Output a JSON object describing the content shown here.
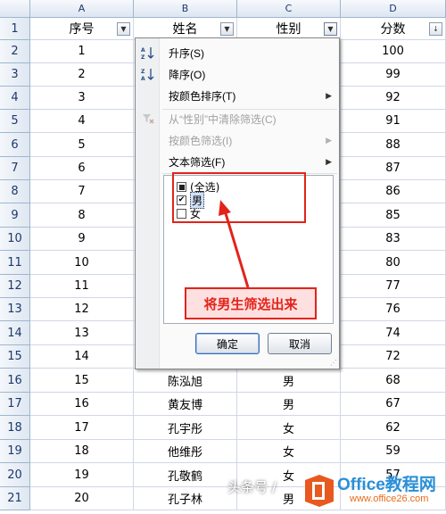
{
  "columns": [
    "A",
    "B",
    "C",
    "D"
  ],
  "row_numbers": [
    "1",
    "2",
    "3",
    "4",
    "5",
    "6",
    "7",
    "8",
    "9",
    "10",
    "11",
    "12",
    "13",
    "14",
    "15",
    "16",
    "17",
    "18",
    "19",
    "20",
    "21"
  ],
  "headers": {
    "seq": "序号",
    "name": "姓名",
    "gender": "性别",
    "score": "分数"
  },
  "rows": [
    {
      "seq": "1",
      "name": "",
      "gender": "",
      "score": "100"
    },
    {
      "seq": "2",
      "name": "",
      "gender": "",
      "score": "99"
    },
    {
      "seq": "3",
      "name": "",
      "gender": "",
      "score": "92"
    },
    {
      "seq": "4",
      "name": "",
      "gender": "",
      "score": "91"
    },
    {
      "seq": "5",
      "name": "",
      "gender": "",
      "score": "88"
    },
    {
      "seq": "6",
      "name": "",
      "gender": "",
      "score": "87"
    },
    {
      "seq": "7",
      "name": "",
      "gender": "",
      "score": "86"
    },
    {
      "seq": "8",
      "name": "",
      "gender": "",
      "score": "85"
    },
    {
      "seq": "9",
      "name": "",
      "gender": "",
      "score": "83"
    },
    {
      "seq": "10",
      "name": "",
      "gender": "",
      "score": "80"
    },
    {
      "seq": "11",
      "name": "",
      "gender": "",
      "score": "77"
    },
    {
      "seq": "12",
      "name": "",
      "gender": "",
      "score": "76"
    },
    {
      "seq": "13",
      "name": "",
      "gender": "",
      "score": "74"
    },
    {
      "seq": "14",
      "name": "",
      "gender": "",
      "score": "72"
    },
    {
      "seq": "15",
      "name": "陈泓旭",
      "gender": "男",
      "score": "68"
    },
    {
      "seq": "16",
      "name": "黄友博",
      "gender": "男",
      "score": "67"
    },
    {
      "seq": "17",
      "name": "孔宇彤",
      "gender": "女",
      "score": "62"
    },
    {
      "seq": "18",
      "name": "他维彤",
      "gender": "女",
      "score": "59"
    },
    {
      "seq": "19",
      "name": "孔敬鹤",
      "gender": "女",
      "score": "57"
    },
    {
      "seq": "20",
      "name": "孔子林",
      "gender": "男",
      "score": ""
    }
  ],
  "menu": {
    "sort_asc": "升序(S)",
    "sort_desc": "降序(O)",
    "sort_by_color": "按颜色排序(T)",
    "clear_filter": "从“性别”中清除筛选(C)",
    "filter_by_color": "按颜色筛选(I)",
    "text_filter": "文本筛选(F)",
    "icons": {
      "sort_asc": "sort-ascending-icon",
      "sort_desc": "sort-descending-icon",
      "clear_filter": "clear-filter-icon"
    }
  },
  "filter_list": [
    {
      "label": "(全选)",
      "state": "partial"
    },
    {
      "label": "男",
      "state": "checked"
    },
    {
      "label": "女",
      "state": "unchecked"
    }
  ],
  "buttons": {
    "ok": "确定",
    "cancel": "取消"
  },
  "annotation": {
    "text": "将男生筛选出来",
    "color": "#e2231a"
  },
  "watermark": {
    "text": "头条号 /",
    "logo_main": "Office教程网",
    "logo_sub": "www.office26.com"
  }
}
